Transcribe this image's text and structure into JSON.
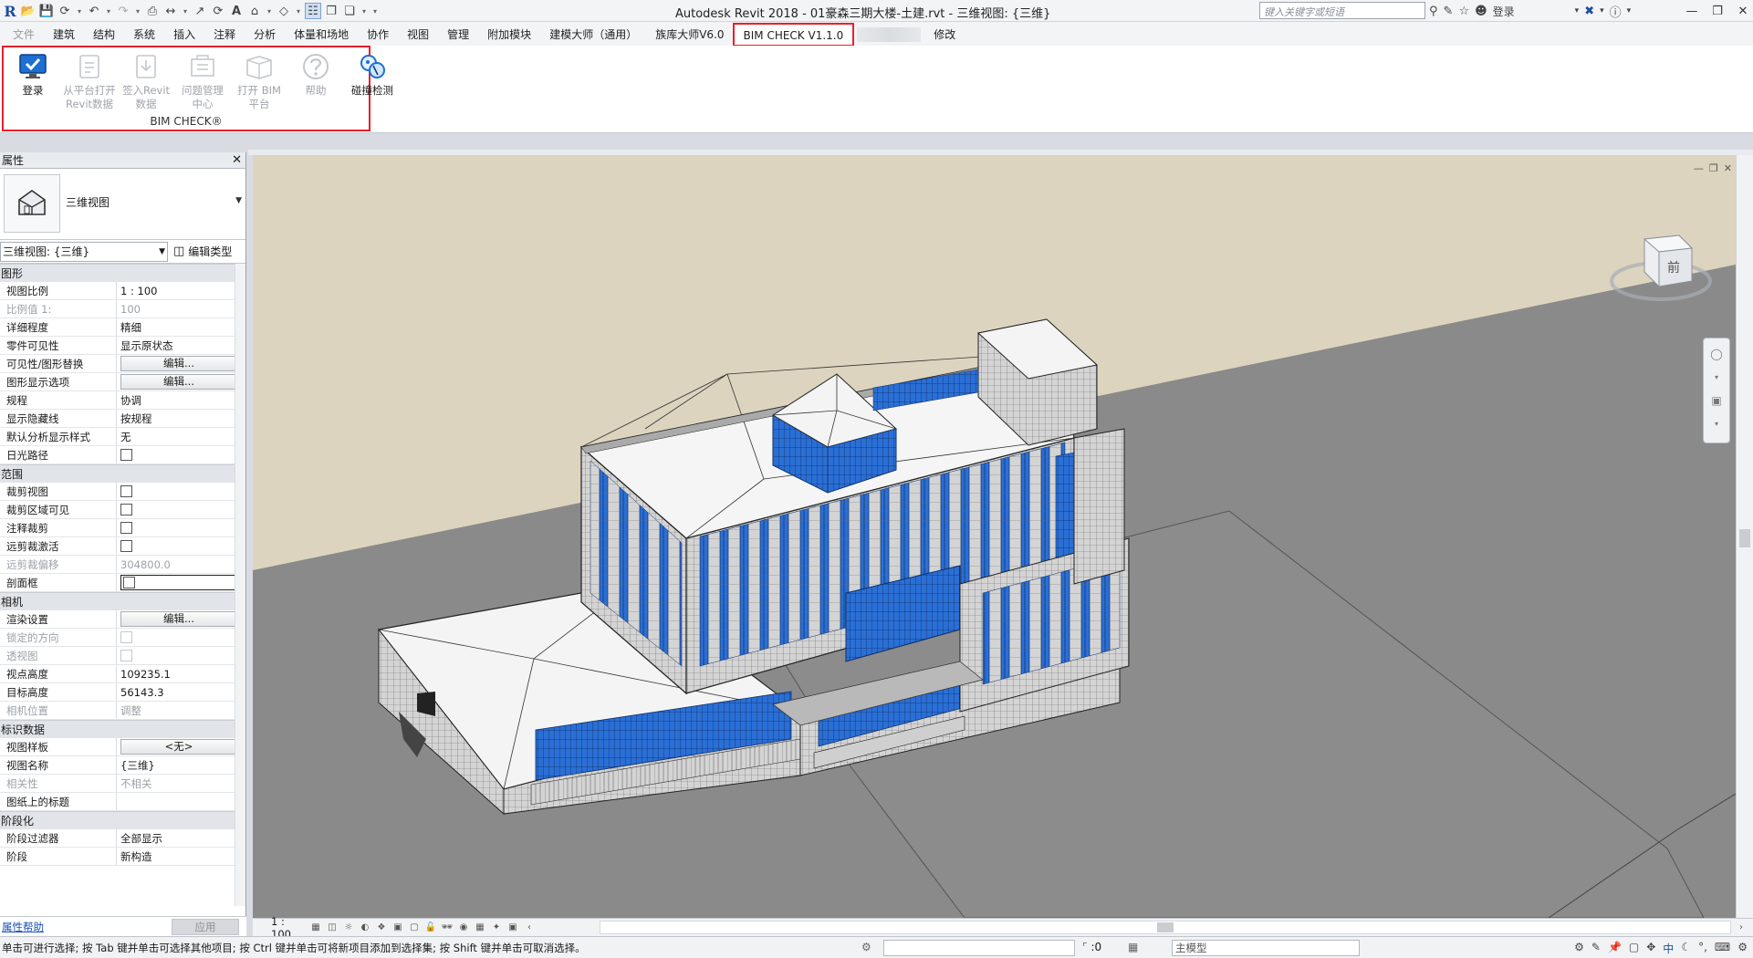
{
  "title_bar": {
    "app_title": "Autodesk Revit 2018 -     01豪森三期大楼-土建.rvt - 三维视图: {三维}",
    "search_placeholder": "键入关键字或短语",
    "signin_label": "登录"
  },
  "ribbon_tabs": [
    {
      "label": "文件",
      "state": "dim"
    },
    {
      "label": "建筑",
      "state": ""
    },
    {
      "label": "结构",
      "state": ""
    },
    {
      "label": "系统",
      "state": ""
    },
    {
      "label": "插入",
      "state": ""
    },
    {
      "label": "注释",
      "state": ""
    },
    {
      "label": "分析",
      "state": ""
    },
    {
      "label": "体量和场地",
      "state": ""
    },
    {
      "label": "协作",
      "state": ""
    },
    {
      "label": "视图",
      "state": ""
    },
    {
      "label": "管理",
      "state": ""
    },
    {
      "label": "附加模块",
      "state": ""
    },
    {
      "label": "建模大师（通用）",
      "state": ""
    },
    {
      "label": "族库大师V6.0",
      "state": ""
    },
    {
      "label": "BIM CHECK V1.1.0",
      "state": "active"
    },
    {
      "label": "修改",
      "state": ""
    }
  ],
  "ribbon": {
    "group_label": "BIM CHECK®",
    "buttons": [
      {
        "line1": "登录",
        "line2": "",
        "line3": "",
        "enabled": true,
        "icon": "monitor-check-icon"
      },
      {
        "line1": "从平台打开",
        "line2": "Revit数据",
        "line3": "",
        "enabled": false,
        "icon": "open-from-platform-icon"
      },
      {
        "line1": "签入Revit",
        "line2": "数据",
        "line3": "",
        "enabled": false,
        "icon": "checkin-data-icon"
      },
      {
        "line1": "问题管理",
        "line2": "中心",
        "line3": "",
        "enabled": false,
        "icon": "issue-center-icon"
      },
      {
        "line1": "打开 BIM",
        "line2": "平台",
        "line3": "",
        "enabled": false,
        "icon": "open-bim-platform-icon"
      },
      {
        "line1": "帮助",
        "line2": "",
        "line3": "",
        "enabled": false,
        "icon": "help-icon"
      },
      {
        "line1": "碰撞检测",
        "line2": "",
        "line3": "",
        "enabled": true,
        "icon": "clash-detection-icon"
      }
    ]
  },
  "properties": {
    "header": "属性",
    "type_name": "三维视图",
    "instance_selector": "三维视图: {三维}",
    "edit_type_label": "编辑类型",
    "help_link": "属性帮助",
    "apply_label": "应用",
    "categories": [
      {
        "name": "图形",
        "rows": [
          {
            "label": "视图比例",
            "value": "1 : 100",
            "kind": "text",
            "disabled": false
          },
          {
            "label": "比例值 1:",
            "value": "100",
            "kind": "text",
            "disabled": true
          },
          {
            "label": "详细程度",
            "value": "精细",
            "kind": "text",
            "disabled": false
          },
          {
            "label": "零件可见性",
            "value": "显示原状态",
            "kind": "text",
            "disabled": false
          },
          {
            "label": "可见性/图形替换",
            "value": "编辑...",
            "kind": "button",
            "disabled": false
          },
          {
            "label": "图形显示选项",
            "value": "编辑...",
            "kind": "button",
            "disabled": false
          },
          {
            "label": "规程",
            "value": "协调",
            "kind": "text",
            "disabled": false
          },
          {
            "label": "显示隐藏线",
            "value": "按规程",
            "kind": "text",
            "disabled": false
          },
          {
            "label": "默认分析显示样式",
            "value": "无",
            "kind": "text",
            "disabled": false
          },
          {
            "label": "日光路径",
            "value": "",
            "kind": "check",
            "disabled": false
          }
        ]
      },
      {
        "name": "范围",
        "rows": [
          {
            "label": "裁剪视图",
            "value": "",
            "kind": "check",
            "disabled": false
          },
          {
            "label": "裁剪区域可见",
            "value": "",
            "kind": "check",
            "disabled": false
          },
          {
            "label": "注释裁剪",
            "value": "",
            "kind": "check",
            "disabled": false
          },
          {
            "label": "远剪裁激活",
            "value": "",
            "kind": "check",
            "disabled": false
          },
          {
            "label": "远剪裁偏移",
            "value": "304800.0",
            "kind": "text",
            "disabled": true
          },
          {
            "label": "剖面框",
            "value": "",
            "kind": "check-selected",
            "disabled": false
          }
        ]
      },
      {
        "name": "相机",
        "rows": [
          {
            "label": "渲染设置",
            "value": "编辑...",
            "kind": "button",
            "disabled": false
          },
          {
            "label": "锁定的方向",
            "value": "",
            "kind": "check",
            "disabled": true
          },
          {
            "label": "透视图",
            "value": "",
            "kind": "check",
            "disabled": true
          },
          {
            "label": "视点高度",
            "value": "109235.1",
            "kind": "text",
            "disabled": false
          },
          {
            "label": "目标高度",
            "value": "56143.3",
            "kind": "text",
            "disabled": false
          },
          {
            "label": "相机位置",
            "value": "调整",
            "kind": "text",
            "disabled": true
          }
        ]
      },
      {
        "name": "标识数据",
        "rows": [
          {
            "label": "视图样板",
            "value": "<无>",
            "kind": "button",
            "disabled": false
          },
          {
            "label": "视图名称",
            "value": "{三维}",
            "kind": "text",
            "disabled": false
          },
          {
            "label": "相关性",
            "value": "不相关",
            "kind": "text",
            "disabled": true
          },
          {
            "label": "图纸上的标题",
            "value": "",
            "kind": "text",
            "disabled": false
          }
        ]
      },
      {
        "name": "阶段化",
        "rows": [
          {
            "label": "阶段过滤器",
            "value": "全部显示",
            "kind": "text",
            "disabled": false
          },
          {
            "label": "阶段",
            "value": "新构造",
            "kind": "text",
            "disabled": false
          }
        ]
      }
    ]
  },
  "view": {
    "scale_label": "1 : 100",
    "viewcube_label": "前"
  },
  "status_bar": {
    "message": "单击可进行选择; 按 Tab 键并单击可选择其他项目; 按 Ctrl 键并单击可将新项目添加到选择集; 按 Shift 键并单击可取消选择。",
    "filter_count": ":0",
    "model_label": "主模型"
  },
  "colors": {
    "highlight_red": "#e8202a",
    "glass_blue": "#2a6fd6",
    "ground_gray": "#8a8a8a",
    "sky_beige": "#ddd4bf"
  }
}
